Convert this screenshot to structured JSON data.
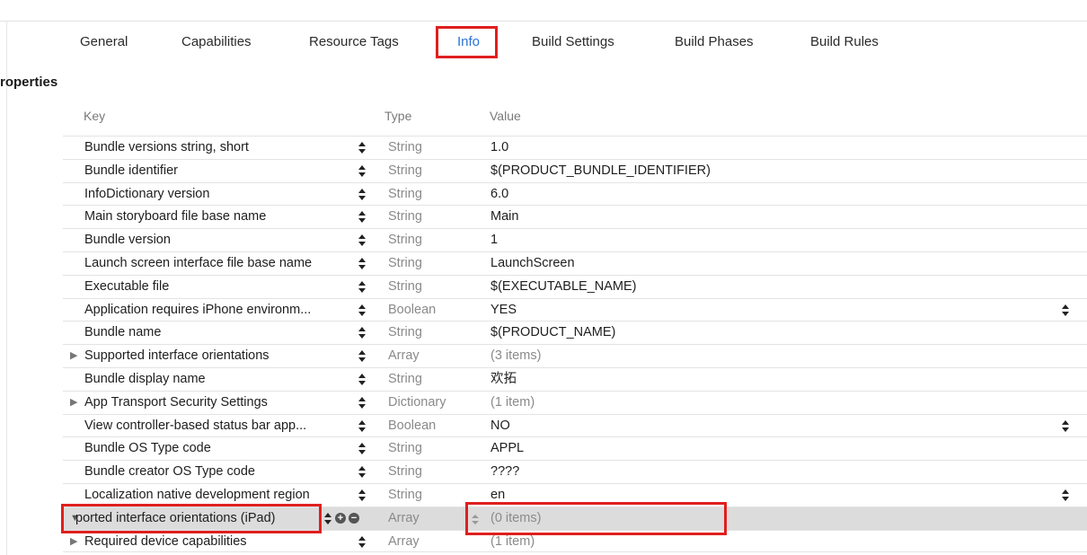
{
  "tabs": [
    {
      "label": "General"
    },
    {
      "label": "Capabilities"
    },
    {
      "label": "Resource Tags"
    },
    {
      "label": "Info"
    },
    {
      "label": "Build Settings"
    },
    {
      "label": "Build Phases"
    },
    {
      "label": "Build Rules"
    }
  ],
  "active_tab": "Info",
  "section_title": "roperties",
  "columns": {
    "key": "Key",
    "type": "Type",
    "value": "Value"
  },
  "rows": [
    {
      "key": "Bundle versions string, short",
      "type": "String",
      "value": "1.0"
    },
    {
      "key": "Bundle identifier",
      "type": "String",
      "value": "$(PRODUCT_BUNDLE_IDENTIFIER)"
    },
    {
      "key": "InfoDictionary version",
      "type": "String",
      "value": "6.0"
    },
    {
      "key": "Main storyboard file base name",
      "type": "String",
      "value": "Main"
    },
    {
      "key": "Bundle version",
      "type": "String",
      "value": "1"
    },
    {
      "key": "Launch screen interface file base name",
      "type": "String",
      "value": "LaunchScreen"
    },
    {
      "key": "Executable file",
      "type": "String",
      "value": "$(EXECUTABLE_NAME)"
    },
    {
      "key": "Application requires iPhone environm...",
      "type": "Boolean",
      "value": "YES"
    },
    {
      "key": "Bundle name",
      "type": "String",
      "value": "$(PRODUCT_NAME)"
    },
    {
      "key": "Supported interface orientations",
      "type": "Array",
      "value": "(3 items)"
    },
    {
      "key": "Bundle display name",
      "type": "String",
      "value": "欢拓"
    },
    {
      "key": "App Transport Security Settings",
      "type": "Dictionary",
      "value": "(1 item)"
    },
    {
      "key": "View controller-based status bar app...",
      "type": "Boolean",
      "value": "NO"
    },
    {
      "key": "Bundle OS Type code",
      "type": "String",
      "value": "APPL"
    },
    {
      "key": "Bundle creator OS Type code",
      "type": "String",
      "value": "????"
    },
    {
      "key": "Localization native development region",
      "type": "String",
      "value": "en"
    },
    {
      "key": "ported interface orientations (iPad)",
      "type": "Array",
      "value": "(0 items)"
    },
    {
      "key": "Required device capabilities",
      "type": "Array",
      "value": "(1 item)"
    }
  ],
  "buttons": {
    "add": "+",
    "remove": "−"
  },
  "colors": {
    "accent": "#2a72d6",
    "highlight_box": "#e01f1f",
    "selected_row": "#dcdcdc"
  }
}
